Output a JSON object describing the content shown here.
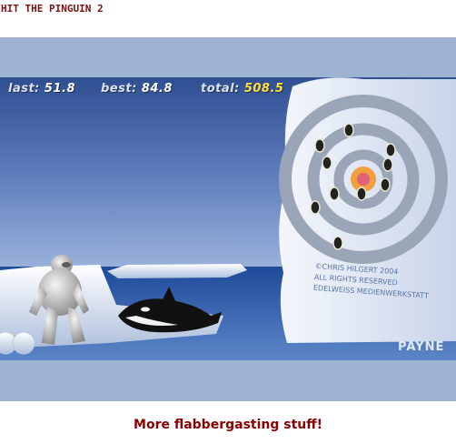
{
  "page": {
    "title": "HIT THE PINGUIN 2"
  },
  "hud": {
    "last_label": "last:",
    "last_value": "51.8",
    "best_label": "best:",
    "best_value": "84.8",
    "total_label": "total:",
    "total_value": "508.5"
  },
  "scene": {
    "copyright_lines": [
      "©CHRIS HILGERT 2004",
      "ALL RIGHTS RESERVED",
      "EDELWEISS MEDIENWERKSTATT"
    ],
    "brand": "PAYNE",
    "colors": {
      "sky": "#5d79b8",
      "water": "#2a56a6",
      "ice": "#e6ecf6",
      "target_ring": "#9aa6b8",
      "bullseye": "#f0a040"
    }
  },
  "footer": {
    "link_text": "More flabbergasting stuff!"
  }
}
